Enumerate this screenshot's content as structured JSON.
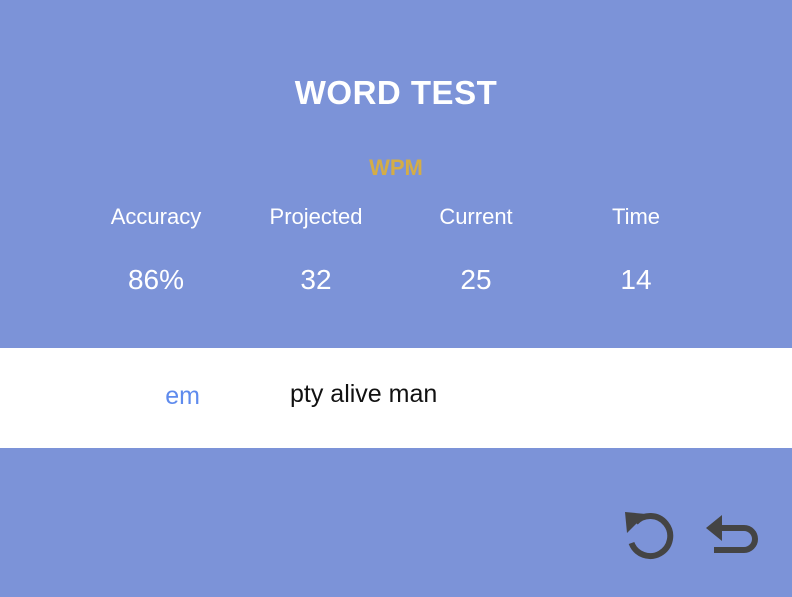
{
  "title": "WORD TEST",
  "wpm_label": "WPM",
  "stats": {
    "accuracy": {
      "label": "Accuracy",
      "value": "86%"
    },
    "projected": {
      "label": "Projected",
      "value": "32"
    },
    "current": {
      "label": "Current",
      "value": "25"
    },
    "time": {
      "label": "Time",
      "value": "14"
    }
  },
  "typing": {
    "typed": "em",
    "remaining": "pty alive man"
  },
  "buttons": {
    "restart": "restart-icon",
    "back": "back-icon"
  },
  "colors": {
    "background": "#7c93d8",
    "wpm_label": "#d4ad46",
    "typed_text": "#5f8bed",
    "icon": "#444444"
  }
}
